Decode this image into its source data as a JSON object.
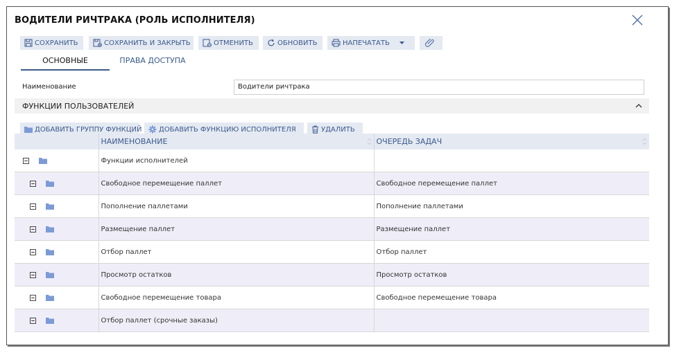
{
  "dialog": {
    "title": "ВОДИТЕЛИ РИЧТРАКА (РОЛЬ ИСПОЛНИТЕЛЯ)",
    "close_icon": "close-icon"
  },
  "toolbar": {
    "save": "СОХРАНИТЬ",
    "save_close": "СОХРАНИТЬ И ЗАКРЫТЬ",
    "cancel": "ОТМЕНИТЬ",
    "refresh": "ОБНОВИТЬ",
    "print": "НАПЕЧАТАТЬ"
  },
  "tabs": {
    "main": "ОСНОВНЫЕ",
    "access": "ПРАВА ДОСТУПА"
  },
  "form": {
    "name_label": "Наименование",
    "name_value": "Водители ричтрака"
  },
  "section": {
    "title": "ФУНКЦИИ ПОЛЬЗОВАТЕЛЕЙ"
  },
  "subtoolbar": {
    "add_group": "ДОБАВИТЬ ГРУППУ ФУНКЦИЙ",
    "add_function": "ДОБАВИТЬ ФУНКЦИЮ ИСПОЛНИТЕЛЯ",
    "delete": "УДАЛИТЬ"
  },
  "grid": {
    "columns": [
      "",
      "НАИМЕНОВАНИЕ",
      "ОЧЕРЕДЬ ЗАДАЧ"
    ],
    "rows": [
      {
        "level": 0,
        "name": "Функции исполнителей",
        "queue": ""
      },
      {
        "level": 1,
        "name": "Свободное перемещение паллет",
        "queue": "Свободное перемещение паллет"
      },
      {
        "level": 1,
        "name": "Пополнение паллетами",
        "queue": "Пополнение паллетами"
      },
      {
        "level": 1,
        "name": "Размещение паллет",
        "queue": "Размещение паллет"
      },
      {
        "level": 1,
        "name": "Отбор паллет",
        "queue": "Отбор паллет"
      },
      {
        "level": 1,
        "name": "Просмотр остатков",
        "queue": "Просмотр остатков"
      },
      {
        "level": 1,
        "name": "Свободное перемещение товара",
        "queue": "Свободное перемещение товара"
      },
      {
        "level": 1,
        "name": "Отбор паллет (срочные заказы)",
        "queue": ""
      }
    ]
  },
  "colors": {
    "accent": "#3b5a8c",
    "button_bg": "#e4e9f2",
    "row_alt": "#efeef8",
    "folder": "#7c9bd6"
  }
}
